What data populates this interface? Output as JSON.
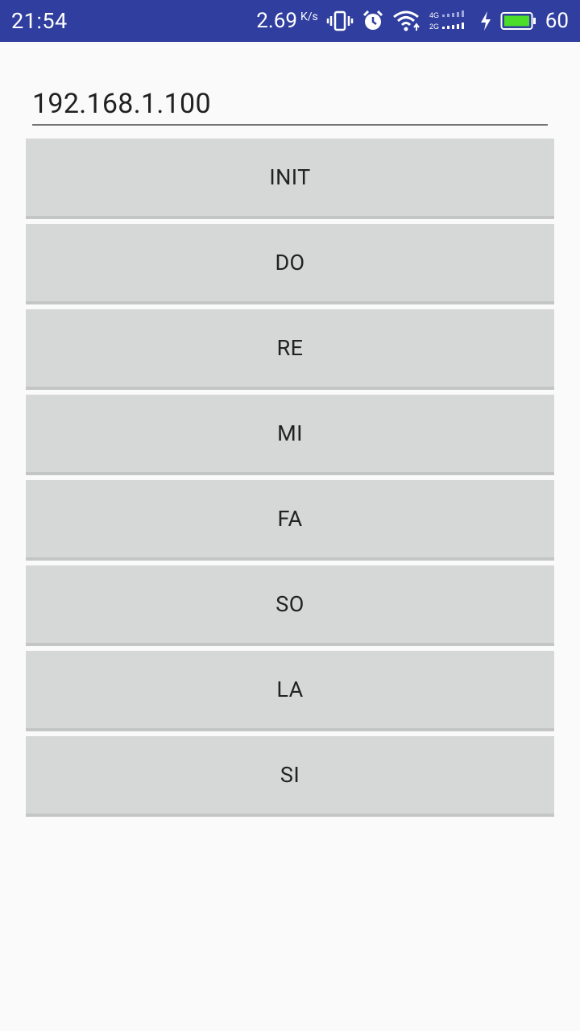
{
  "status_bar": {
    "time": "21:54",
    "speed": "2.69",
    "speed_unit": "K/s",
    "battery": "60"
  },
  "ip_input": {
    "value": "192.168.1.100"
  },
  "buttons": [
    {
      "label": "INIT"
    },
    {
      "label": "DO"
    },
    {
      "label": "RE"
    },
    {
      "label": "MI"
    },
    {
      "label": "FA"
    },
    {
      "label": "SO"
    },
    {
      "label": "LA"
    },
    {
      "label": "SI"
    }
  ]
}
